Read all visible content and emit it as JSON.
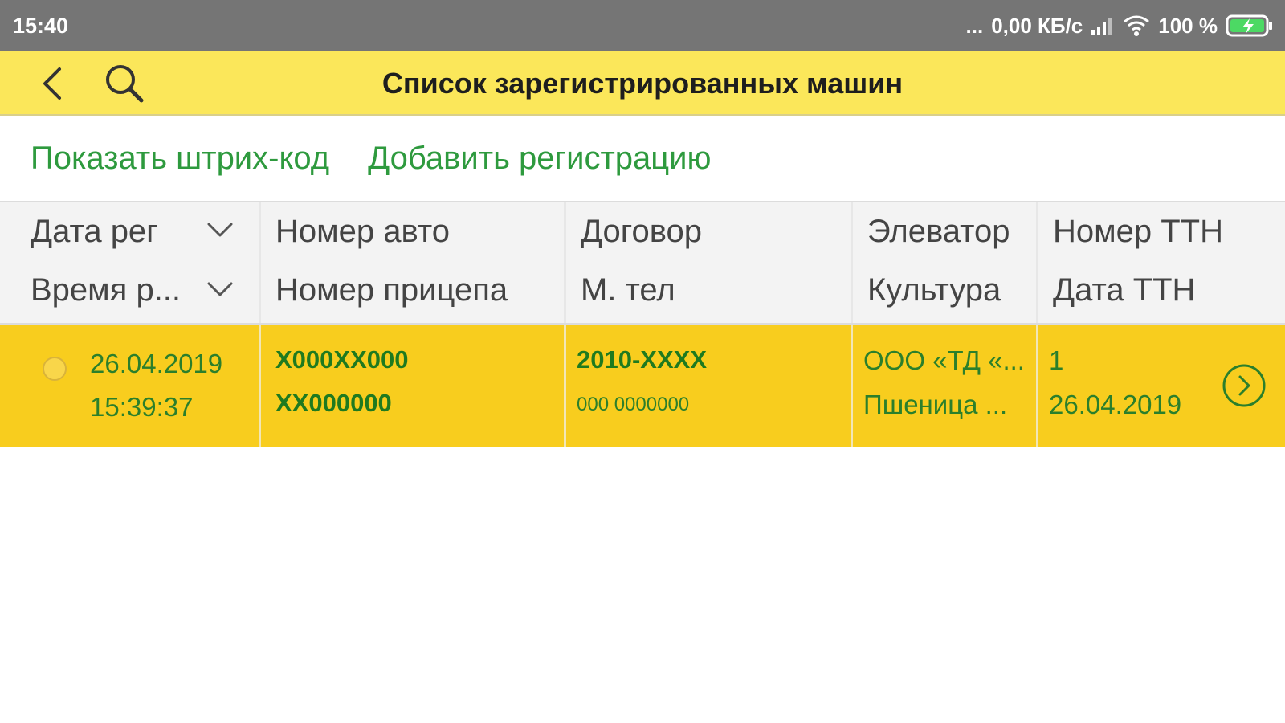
{
  "status_bar": {
    "time": "15:40",
    "dots": "...",
    "speed": "0,00 КБ/с",
    "battery": "100 %",
    "icons": [
      "signal-icon",
      "wifi-icon",
      "battery-charging-icon"
    ]
  },
  "app_bar": {
    "title": "Список зарегистрированных машин",
    "icons": [
      "back-arrow-icon",
      "search-icon"
    ],
    "color": "#fbe75a"
  },
  "actions": {
    "show_barcode": "Показать штрих-код",
    "add_registration": "Добавить регистрацию",
    "color": "#2e9a3e"
  },
  "table": {
    "columns": [
      {
        "line1": "Дата рег",
        "line2": "Время р..."
      },
      {
        "line1": "Номер авто",
        "line2": "Номер прицепа"
      },
      {
        "line1": "Договор",
        "line2": "М. тел"
      },
      {
        "line1": "Элеватор",
        "line2": "Культура"
      },
      {
        "line1": "Номер ТТН",
        "line2": "Дата ТТН"
      }
    ],
    "rows": [
      {
        "reg_date": "26.04.2019",
        "reg_time": "15:39:37",
        "car_number": "X000XX000",
        "trailer_number": "XX000000",
        "contract": "2010-XXXX",
        "phone": "000 0000000",
        "elevator": "ООО «ТД «...",
        "crop": "Пшеница ...",
        "ttn_number": "1",
        "ttn_date": "26.04.2019"
      }
    ],
    "selected_row_color": "#f8cd1e"
  }
}
